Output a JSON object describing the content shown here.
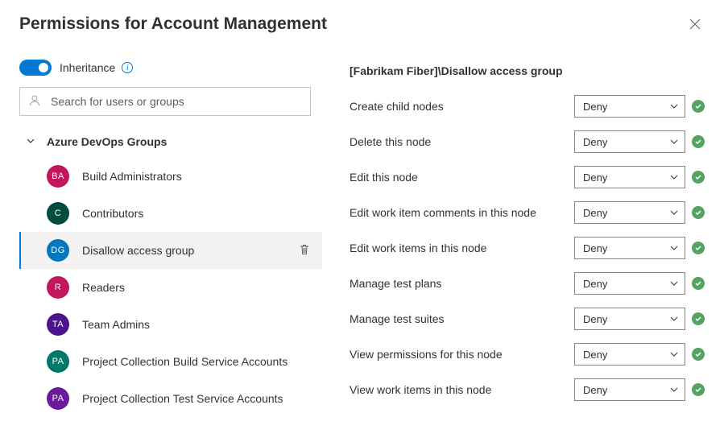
{
  "title": "Permissions for Account Management",
  "inheritance": {
    "label": "Inheritance",
    "on": true
  },
  "search": {
    "placeholder": "Search for users or groups"
  },
  "section": {
    "heading": "Azure DevOps Groups"
  },
  "groups": [
    {
      "initials": "BA",
      "label": "Build Administrators",
      "color": "#c2185b",
      "selected": false
    },
    {
      "initials": "C",
      "label": "Contributors",
      "color": "#004d40",
      "selected": false
    },
    {
      "initials": "DG",
      "label": "Disallow access group",
      "color": "#0277bd",
      "selected": true
    },
    {
      "initials": "R",
      "label": "Readers",
      "color": "#c2185b",
      "selected": false
    },
    {
      "initials": "TA",
      "label": "Team Admins",
      "color": "#4a148c",
      "selected": false
    },
    {
      "initials": "PA",
      "label": "Project Collection Build Service Accounts",
      "color": "#00796b",
      "selected": false
    },
    {
      "initials": "PA",
      "label": "Project Collection Test Service Accounts",
      "color": "#6a1b9a",
      "selected": false
    }
  ],
  "right": {
    "title": "[Fabrikam Fiber]\\Disallow access group",
    "permissions": [
      {
        "label": "Create child nodes",
        "value": "Deny"
      },
      {
        "label": "Delete this node",
        "value": "Deny"
      },
      {
        "label": "Edit this node",
        "value": "Deny"
      },
      {
        "label": "Edit work item comments in this node",
        "value": "Deny"
      },
      {
        "label": "Edit work items in this node",
        "value": "Deny"
      },
      {
        "label": "Manage test plans",
        "value": "Deny"
      },
      {
        "label": "Manage test suites",
        "value": "Deny"
      },
      {
        "label": "View permissions for this node",
        "value": "Deny"
      },
      {
        "label": "View work items in this node",
        "value": "Deny"
      }
    ]
  }
}
